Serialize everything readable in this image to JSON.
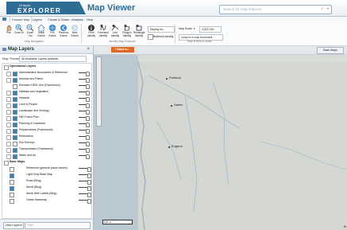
{
  "header": {
    "logo_top": "Oregon",
    "logo_main": "EXPLORER",
    "title": "Map Viewer",
    "search_placeholder": "Search for map features",
    "search_icon": "search-icon",
    "search_caret": "▾"
  },
  "tabs": [
    {
      "label": "Explore Map",
      "active": true
    },
    {
      "label": "Layers",
      "active": false
    },
    {
      "label": "Create & Share",
      "active": false
    },
    {
      "label": "Analysis",
      "active": false
    },
    {
      "label": "Help",
      "active": false
    }
  ],
  "ribbon": {
    "navigation_group": "Map Navigation",
    "identify_group": "Identify Map Features",
    "extent_group": "Map Extent & Scale",
    "buttons": [
      {
        "label": "Pan",
        "icon": "hand-icon"
      },
      {
        "label": "Zoom In",
        "icon": "zoom-in-icon"
      },
      {
        "label": "Zoom Out",
        "icon": "zoom-out-icon"
      },
      {
        "label": "Initial Extent",
        "icon": "home-icon"
      },
      {
        "label": "Full Extent",
        "icon": "globe-icon"
      },
      {
        "label": "Previous Extent",
        "icon": "back-icon"
      },
      {
        "label": "Next Extent",
        "icon": "next-icon"
      },
      {
        "label": "Point Identify",
        "icon": "point-identify-icon"
      },
      {
        "label": "Freehand Identify",
        "icon": "freehand-identify-icon"
      },
      {
        "label": "Line Identify",
        "icon": "line-identify-icon"
      },
      {
        "label": "Polygon Identify",
        "icon": "polygon-identify-icon"
      },
      {
        "label": "Rectangle Identify",
        "icon": "rectangle-identify-icon"
      }
    ],
    "display_for": "Display for...",
    "buffered_identify": "Buffered Identify",
    "map_scale_label": "Map Scale: 1:",
    "map_scale_value": "4,822,334",
    "jump_to_bookmark": "Jump to a map bookmark"
  },
  "panel": {
    "title": "Map Layers",
    "theme_label": "Map Theme",
    "theme_value": "All Available Layers (default)",
    "sections": [
      {
        "title": "Operational Layers",
        "items": [
          {
            "label": "Administrative Boundaries & Reference",
            "checked": true
          },
          {
            "label": "Animals and Plants",
            "checked": true
          },
          {
            "label": "Elevation DEM 10m (Framework)",
            "checked": false
          },
          {
            "label": "Habitats and Vegetation",
            "checked": true
          },
          {
            "label": "Hazards",
            "checked": true
          },
          {
            "label": "Land & People",
            "checked": true
          },
          {
            "label": "Landscape and Geology",
            "checked": true
          },
          {
            "label": "NW Forest Plan",
            "checked": true
          },
          {
            "label": "Planning & Cadastral",
            "checked": true
          },
          {
            "label": "Preparedness (Framework)",
            "checked": true
          },
          {
            "label": "Restoration",
            "checked": true
          },
          {
            "label": "Soil Surveys",
            "checked": false
          },
          {
            "label": "Transportation (Framework)",
            "checked": true
          },
          {
            "label": "Water and Air",
            "checked": true
          }
        ]
      },
      {
        "title": "Base Maps",
        "items": [
          {
            "label": "Reference (general place names)",
            "checked": false
          },
          {
            "label": "Light Gray Base Map",
            "checked": true
          },
          {
            "label": "Road (Bing)",
            "checked": false
          },
          {
            "label": "Aerial (Bing)",
            "checked": true
          },
          {
            "label": "Aerial With Labels (Bing)",
            "checked": false
          },
          {
            "label": "Ocean Basemap",
            "checked": false
          }
        ]
      }
    ],
    "view_legend": "View Legend",
    "filter_placeholder": "Filter"
  },
  "map": {
    "want_label": "I Want to...",
    "basemaps_label": "Base Maps",
    "city_labels": [
      "Portland",
      "Salem",
      "Eugene"
    ],
    "scale_label": "100 mi",
    "edge_label": "W"
  }
}
